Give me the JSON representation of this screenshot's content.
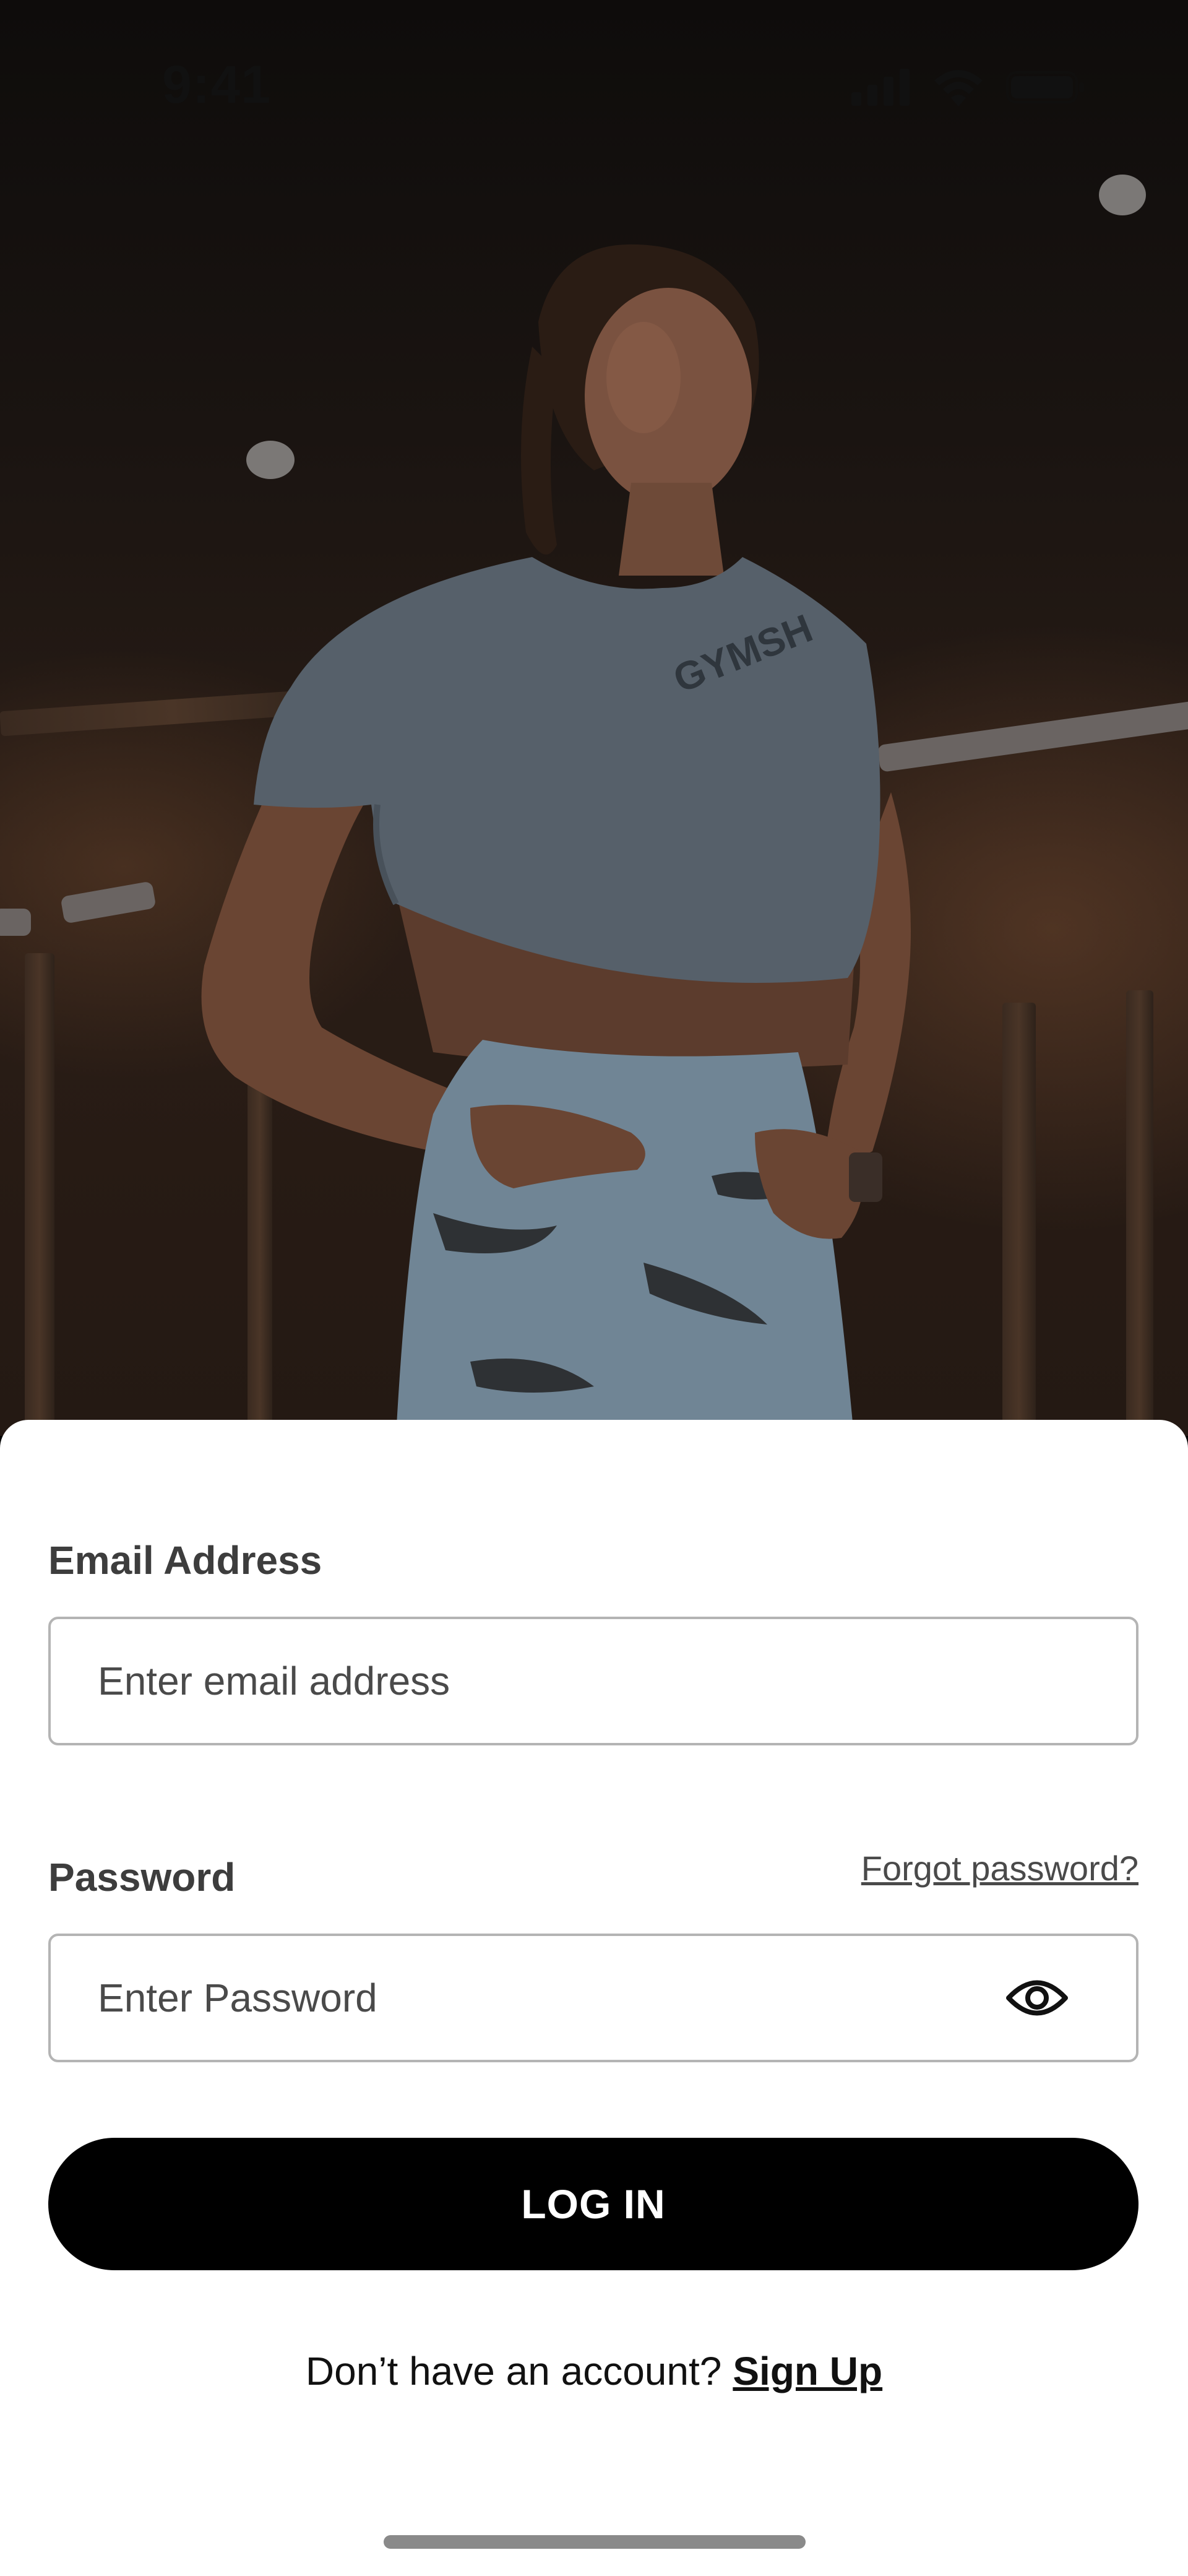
{
  "status_bar": {
    "time": "9:41",
    "icons": [
      "cellular-signal-icon",
      "wifi-icon",
      "battery-icon"
    ]
  },
  "hero": {
    "image": "gym-athlete-photo",
    "shirt_print": "GYMSH"
  },
  "form": {
    "email": {
      "label": "Email Address",
      "placeholder": "Enter email address",
      "value": ""
    },
    "password": {
      "label": "Password",
      "placeholder": "Enter Password",
      "value": "",
      "toggle_icon": "eye-icon"
    },
    "forgot_password": "Forgot password?",
    "login_button": "LOG IN"
  },
  "signup": {
    "prompt": "Don’t have an account?",
    "link": "Sign Up"
  },
  "colors": {
    "sheet_background": "#ffffff",
    "button_background": "#000000",
    "button_text": "#ffffff",
    "label_text": "#3d3d3d",
    "input_border": "#b4b4b4"
  }
}
